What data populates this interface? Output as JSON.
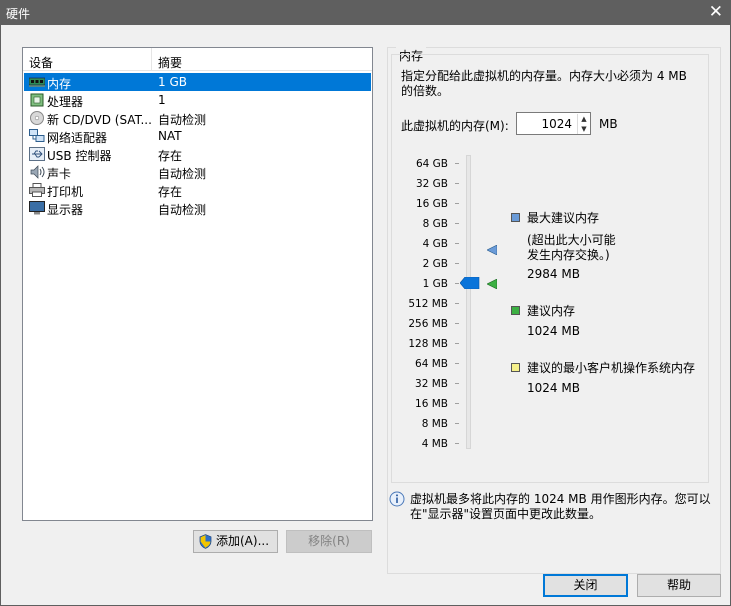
{
  "window": {
    "title": "硬件",
    "close_glyph": "✕"
  },
  "device_table": {
    "columns": [
      "设备",
      "摘要"
    ],
    "rows": [
      {
        "name": "内存",
        "summary": "1 GB",
        "icon": "memory-icon",
        "selected": true
      },
      {
        "name": "处理器",
        "summary": "1",
        "icon": "processor-icon",
        "selected": false
      },
      {
        "name": "新 CD/DVD (SAT...",
        "summary": "自动检测",
        "icon": "cd-dvd-icon",
        "selected": false
      },
      {
        "name": "网络适配器",
        "summary": "NAT",
        "icon": "network-adapter-icon",
        "selected": false
      },
      {
        "name": "USB 控制器",
        "summary": "存在",
        "icon": "usb-icon",
        "selected": false
      },
      {
        "name": "声卡",
        "summary": "自动检测",
        "icon": "sound-card-icon",
        "selected": false
      },
      {
        "name": "打印机",
        "summary": "存在",
        "icon": "printer-icon",
        "selected": false
      },
      {
        "name": "显示器",
        "summary": "自动检测",
        "icon": "display-icon",
        "selected": false
      }
    ]
  },
  "buttons": {
    "add": "添加(A)...",
    "remove": "移除(R)",
    "close": "关闭",
    "help": "帮助"
  },
  "memory": {
    "group_title": "内存",
    "description": "指定分配给此虚拟机的内存量。内存大小必须为 4 MB 的倍数。",
    "field_label": "此虚拟机的内存(M):",
    "value": "1024",
    "unit": "MB",
    "scale": [
      "64 GB",
      "32 GB",
      "16 GB",
      "8 GB",
      "4 GB",
      "2 GB",
      "1 GB",
      "512 MB",
      "256 MB",
      "128 MB",
      "64 MB",
      "32 MB",
      "16 MB",
      "8 MB",
      "4 MB"
    ],
    "slider_value": "1 GB",
    "legend": {
      "max_recommended": {
        "title": "最大建议内存",
        "note_line1": "(超出此大小可能",
        "note_line2": "发生内存交换。)",
        "value": "2984 MB",
        "color": "#6a9bd8"
      },
      "recommended": {
        "title": "建议内存",
        "value": "1024 MB",
        "color": "#3cb043"
      },
      "min_guest_os": {
        "title": "建议的最小客户机操作系统内存",
        "value": "1024 MB",
        "color": "#f5f08a"
      }
    },
    "info_text": "虚拟机最多将此内存的 1024 MB 用作图形内存。您可以在\"显示器\"设置页面中更改此数量。"
  },
  "colors": {
    "title_bar": "#5f5f5f",
    "selection": "#0078d7",
    "slider_thumb": "#0a74da"
  }
}
